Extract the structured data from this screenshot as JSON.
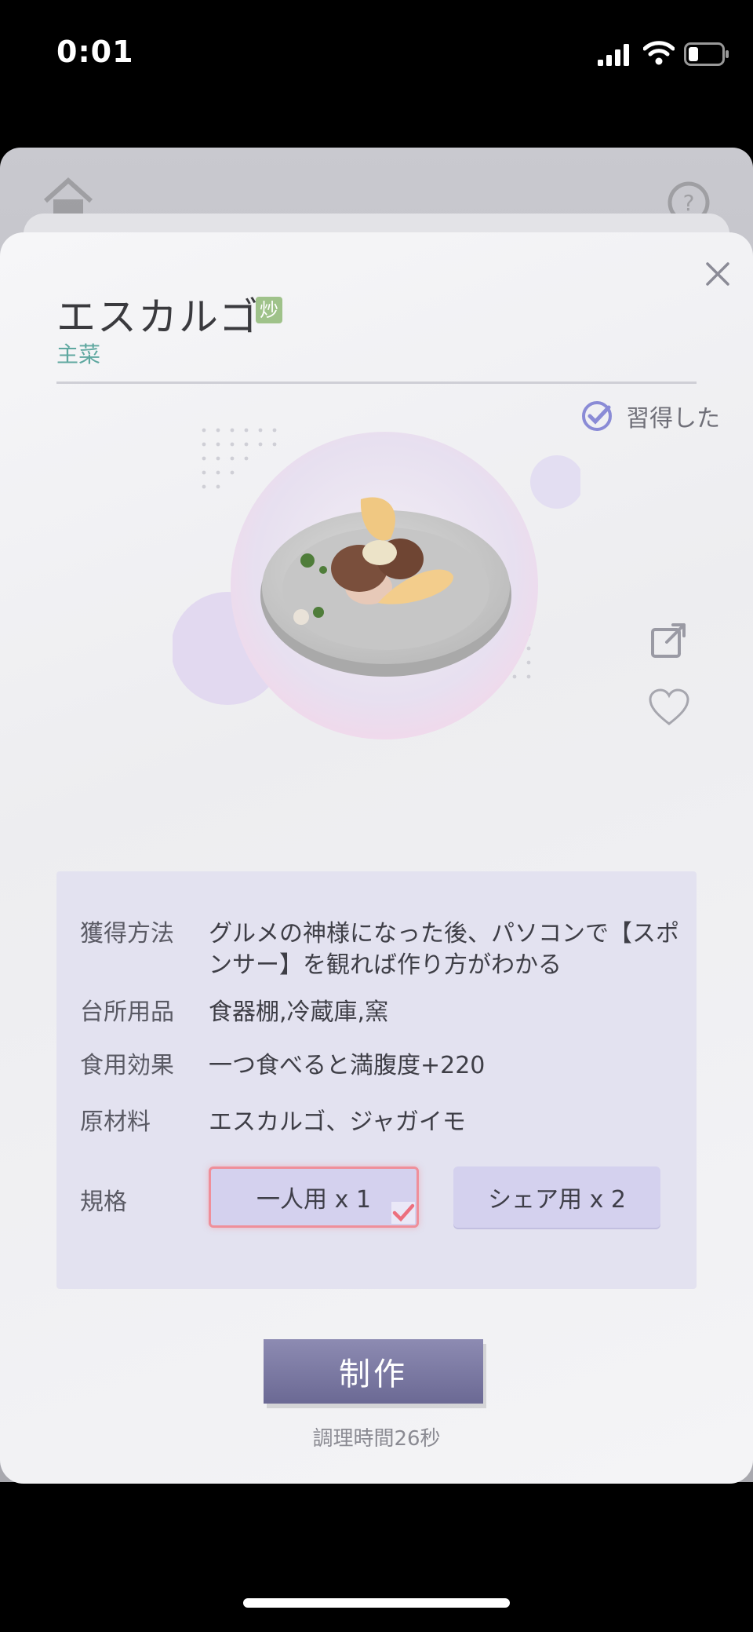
{
  "status_bar": {
    "time": "0:01"
  },
  "dialog": {
    "title": "エスカルゴ",
    "badge": "炒",
    "category": "主菜",
    "learned_label": "習得した"
  },
  "info": {
    "method_label": "獲得方法",
    "method_value": "グルメの神様になった後、パソコンで【スポンサー】を観れば作り方がわかる",
    "tools_label": "台所用品",
    "tools_value": "食器棚,冷蔵庫,窯",
    "effect_label": "食用効果",
    "effect_value": "一つ食べると満腹度+220",
    "materials_label": "原材料",
    "materials_value": "エスカルゴ、ジャガイモ",
    "spec_label": "規格",
    "spec_options": [
      "一人用 x 1",
      "シェア用 x 2"
    ]
  },
  "actions": {
    "craft_label": "制作",
    "cook_time": "調理時間26秒"
  },
  "colors": {
    "accent": "#6b6994",
    "category": "#5fa8a0",
    "selected_border": "#ef8f9a",
    "panel": "#e3e2f0"
  }
}
